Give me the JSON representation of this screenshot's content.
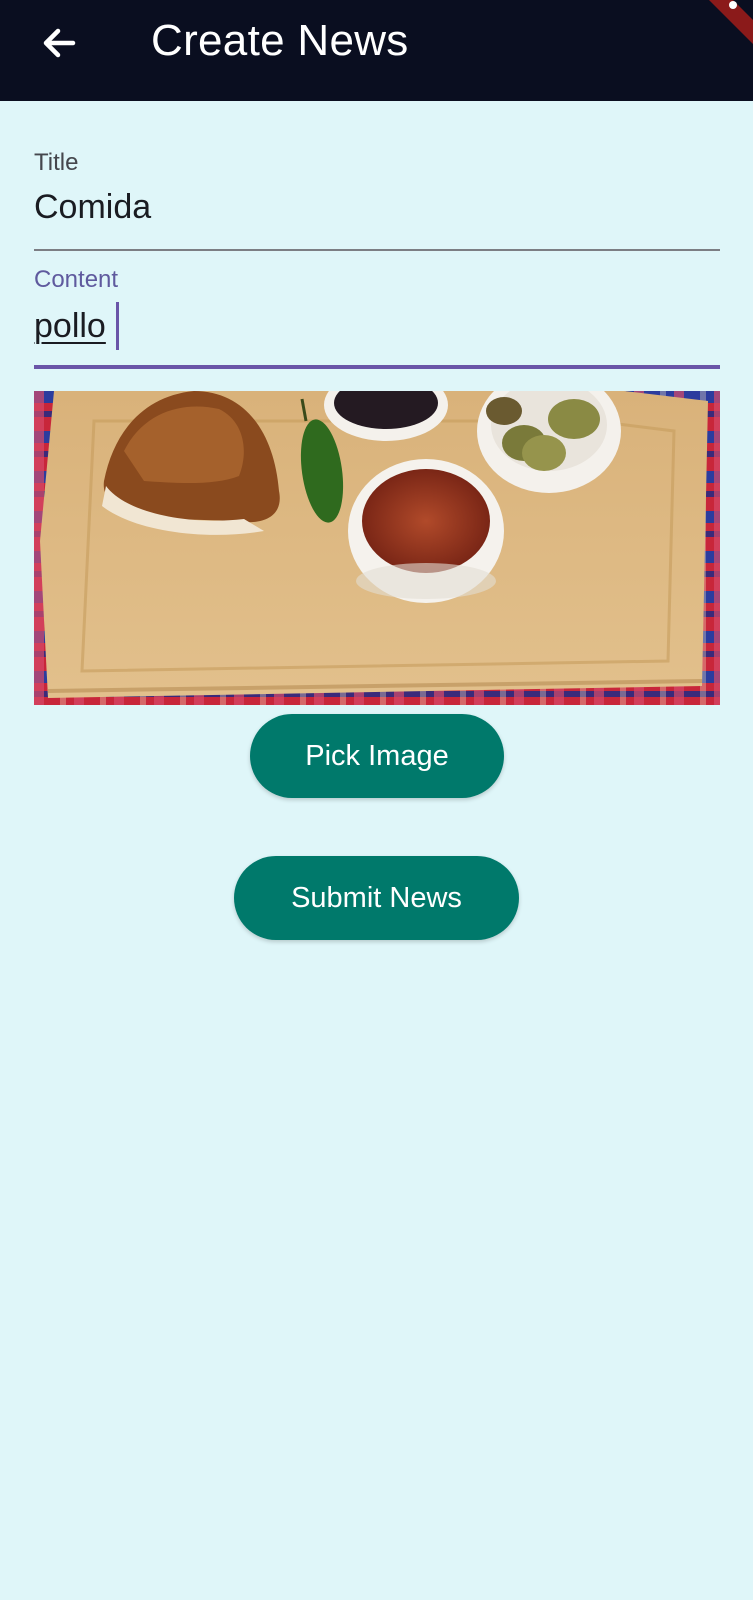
{
  "app_bar": {
    "title": "Create News",
    "back_icon": "arrow-back-icon",
    "background": "#0a0e20"
  },
  "form": {
    "title_field": {
      "label": "Title",
      "value": "Comida"
    },
    "content_field": {
      "label": "Content",
      "value": "pollo"
    },
    "image": {
      "icon": "food-photo"
    },
    "pick_image_label": "Pick Image",
    "submit_label": "Submit News"
  },
  "colors": {
    "page_background": "#dff6f9",
    "button": "#00796b",
    "focus_accent": "#6a55a8"
  }
}
